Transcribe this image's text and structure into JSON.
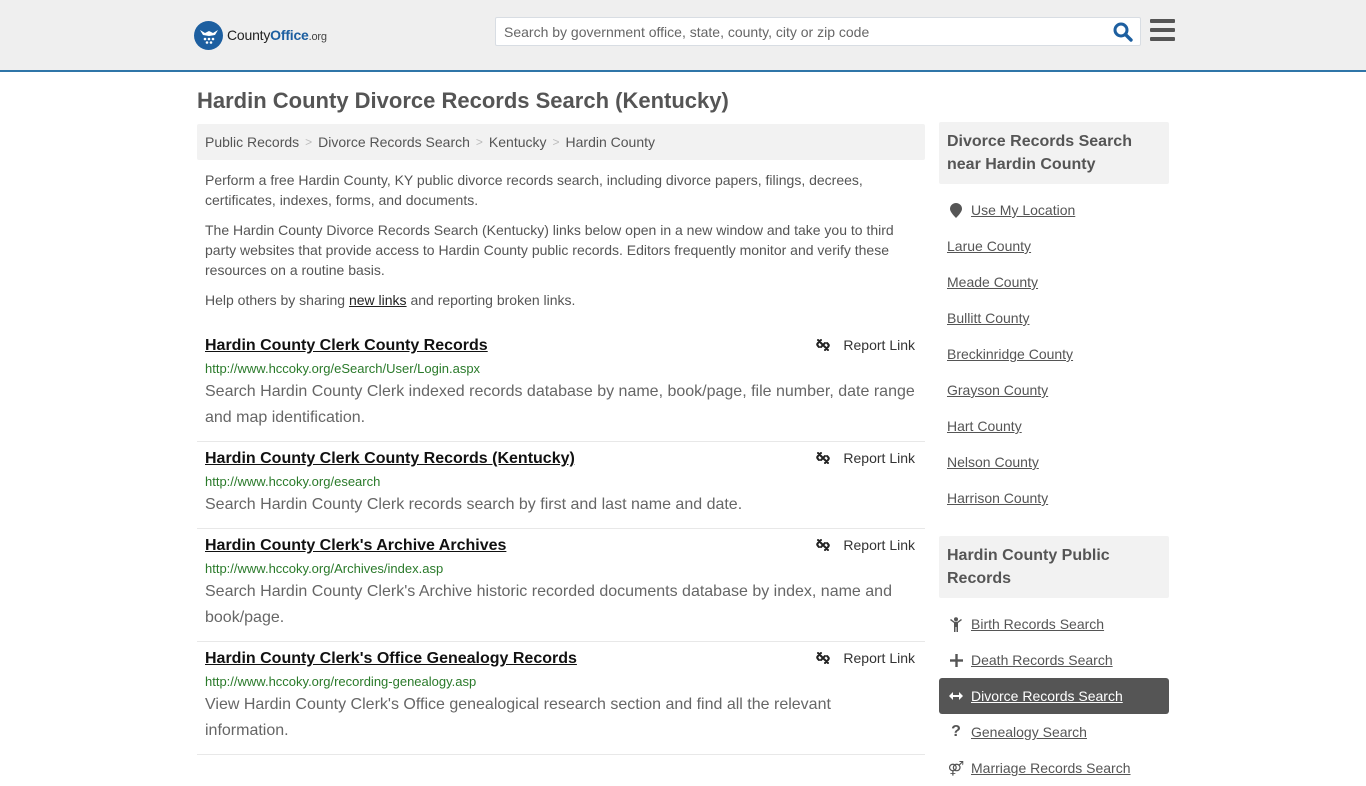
{
  "header": {
    "logo": {
      "name_prefix": "County",
      "name_brand": "Office",
      "name_suffix": ".org"
    },
    "search": {
      "placeholder": "Search by government office, state, county, city or zip code",
      "value": ""
    },
    "colors": {
      "brand": "#1d5fa0",
      "header_border": "#2f75a8"
    }
  },
  "page": {
    "title": "Hardin County Divorce Records Search (Kentucky)"
  },
  "breadcrumb": [
    "Public Records",
    "Divorce Records Search",
    "Kentucky",
    "Hardin County"
  ],
  "intro": {
    "p1": "Perform a free Hardin County, KY public divorce records search, including divorce papers, filings, decrees, certificates, indexes, forms, and documents.",
    "p2": "The Hardin County Divorce Records Search (Kentucky) links below open in a new window and take you to third party websites that provide access to Hardin County public records. Editors frequently monitor and verify these resources on a routine basis.",
    "p3_before": "Help others by sharing ",
    "p3_link": "new links",
    "p3_after": " and reporting broken links."
  },
  "report_label": "Report Link",
  "results": [
    {
      "title": "Hardin County Clerk County Records",
      "url": "http://www.hccoky.org/eSearch/User/Login.aspx",
      "description": "Search Hardin County Clerk indexed records database by name, book/page, file number, date range and map identification."
    },
    {
      "title": "Hardin County Clerk County Records (Kentucky)",
      "url": "http://www.hccoky.org/esearch",
      "description": "Search Hardin County Clerk records search by first and last name and date."
    },
    {
      "title": "Hardin County Clerk's Archive Archives",
      "url": "http://www.hccoky.org/Archives/index.asp",
      "description": "Search Hardin County Clerk's Archive historic recorded documents database by index, name and book/page."
    },
    {
      "title": "Hardin County Clerk's Office Genealogy Records",
      "url": "http://www.hccoky.org/recording-genealogy.asp",
      "description": "View Hardin County Clerk's Office genealogical research section and find all the relevant information."
    }
  ],
  "sidebar": {
    "near": {
      "heading": "Divorce Records Search near Hardin County",
      "use_location": "Use My Location",
      "counties": [
        "Larue County",
        "Meade County",
        "Bullitt County",
        "Breckinridge County",
        "Grayson County",
        "Hart County",
        "Nelson County",
        "Harrison County"
      ]
    },
    "public": {
      "heading": "Hardin County Public Records",
      "items": [
        {
          "label": "Birth Records Search",
          "icon": "child-icon",
          "active": false
        },
        {
          "label": "Death Records Search",
          "icon": "plus-icon",
          "active": false
        },
        {
          "label": "Divorce Records Search",
          "icon": "arrows-h-icon",
          "active": true
        },
        {
          "label": "Genealogy Search",
          "icon": "question-icon",
          "active": false
        },
        {
          "label": "Marriage Records Search",
          "icon": "venus-mars-icon",
          "active": false
        }
      ]
    }
  }
}
